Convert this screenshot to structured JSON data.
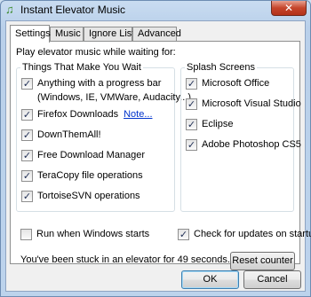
{
  "window": {
    "title": "Instant Elevator Music",
    "icon": "music-note-icon",
    "close_glyph": "✕"
  },
  "tabs": [
    {
      "label": "Settings",
      "active": true
    },
    {
      "label": "Music",
      "active": false
    },
    {
      "label": "Ignore List",
      "active": false
    },
    {
      "label": "Advanced",
      "active": false
    }
  ],
  "settings": {
    "intro": "Play elevator music while waiting for:",
    "wait_group": {
      "title": "Things That Make You Wait",
      "items": [
        {
          "label": "Anything with a progress bar",
          "continuation": "(Windows, IE, VMWare, Audacity...)",
          "checked": true
        },
        {
          "label": "Firefox Downloads",
          "link": "Note...",
          "checked": true
        },
        {
          "label": "DownThemAll!",
          "checked": true
        },
        {
          "label": "Free Download Manager",
          "checked": true
        },
        {
          "label": "TeraCopy file operations",
          "checked": true
        },
        {
          "label": "TortoiseSVN operations",
          "checked": true
        }
      ]
    },
    "splash_group": {
      "title": "Splash Screens",
      "items": [
        {
          "label": "Microsoft Office",
          "checked": true
        },
        {
          "label": "Microsoft Visual Studio",
          "checked": true
        },
        {
          "label": "Eclipse",
          "checked": true
        },
        {
          "label": "Adobe Photoshop CS5",
          "checked": true
        }
      ]
    },
    "run_on_startup": {
      "label": "Run when Windows starts",
      "checked": false
    },
    "check_updates": {
      "label": "Check for updates on startup",
      "checked": true
    },
    "stuck_message": "You've been stuck in an elevator for 49 seconds.",
    "reset_label": "Reset counter"
  },
  "footer": {
    "ok_label": "OK",
    "cancel_label": "Cancel"
  }
}
